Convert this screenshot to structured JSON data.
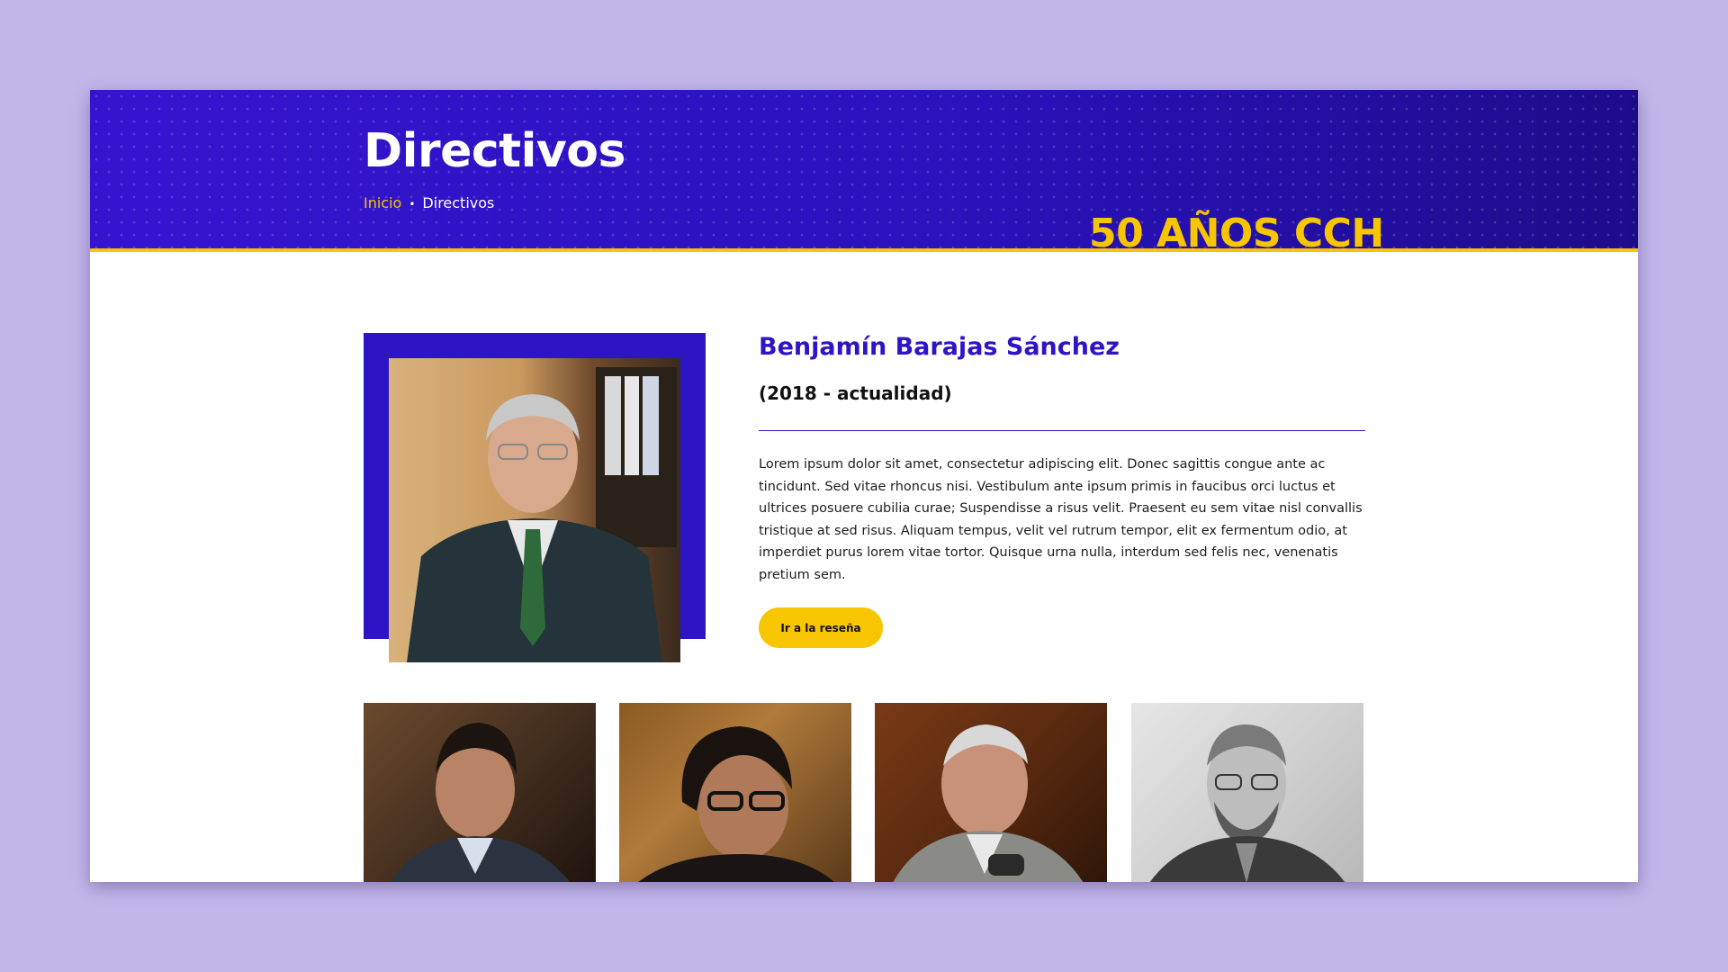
{
  "header": {
    "title": "Directivos",
    "breadcrumb": {
      "home": "Inicio",
      "separator": "•",
      "current": "Directivos"
    },
    "anniversary": "50 AÑOS CCH"
  },
  "featured": {
    "name": "Benjamín Barajas Sánchez",
    "period": "(2018 - actualidad)",
    "bio": "Lorem ipsum dolor sit amet, consectetur adipiscing elit. Donec sagittis congue ante ac tincidunt. Sed vitae rhoncus nisi. Vestibulum ante ipsum primis in faucibus orci luctus et ultrices posuere cubilia curae; Suspendisse a risus velit. Praesent eu sem vitae nisl convallis tristique at sed risus. Aliquam tempus, velit vel rutrum tempor, elit ex fermentum odio, at imperdiet purus lorem vitae tortor. Quisque urna nulla, interdum sed felis nec, venenatis pretium sem.",
    "button_label": "Ir a la reseña",
    "photo_icon": "person-portrait-icon"
  },
  "gallery": [
    {
      "icon": "person-portrait-icon"
    },
    {
      "icon": "person-portrait-icon"
    },
    {
      "icon": "person-portrait-icon"
    },
    {
      "icon": "person-portrait-icon"
    }
  ],
  "colors": {
    "background": "#c1b6ea",
    "brand_purple": "#2d14c5",
    "accent_yellow": "#f7c600",
    "white": "#ffffff"
  }
}
